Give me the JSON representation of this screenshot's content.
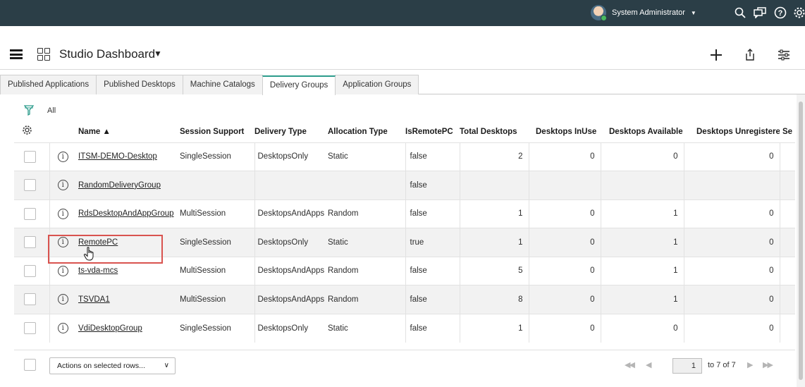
{
  "topbar": {
    "user_name": "System Administrator",
    "icons": [
      "search-icon",
      "chat-icon",
      "help-icon",
      "settings-icon"
    ]
  },
  "header": {
    "title": "Studio Dashboard",
    "icons": [
      "menu-icon",
      "dashboard-grid-icon",
      "add-icon",
      "share-icon",
      "filter-settings-icon"
    ]
  },
  "tabs": [
    {
      "label": "Published Applications",
      "active": false
    },
    {
      "label": "Published Desktops",
      "active": false
    },
    {
      "label": "Machine Catalogs",
      "active": false
    },
    {
      "label": "Delivery Groups",
      "active": true
    },
    {
      "label": "Application Groups",
      "active": false
    }
  ],
  "filter": {
    "label": "All"
  },
  "table": {
    "columns": [
      "Name ▲",
      "Session Support",
      "Delivery Type",
      "Allocation Type",
      "IsRemotePC",
      "Total Desktops",
      "Desktops InUse",
      "Desktops Available",
      "Desktops Unregistered",
      "Se"
    ],
    "rows": [
      {
        "name": "ITSM-DEMO-Desktop",
        "session": "SingleSession",
        "delivery": "DesktopsOnly",
        "allocation": "Static",
        "remote": "false",
        "total": "2",
        "inuse": "0",
        "available": "0",
        "unregistered": "0"
      },
      {
        "name": "RandomDeliveryGroup",
        "session": "",
        "delivery": "",
        "allocation": "",
        "remote": "false",
        "total": "",
        "inuse": "",
        "available": "",
        "unregistered": ""
      },
      {
        "name": "RdsDesktopAndAppGroup",
        "session": "MultiSession",
        "delivery": "DesktopsAndApps",
        "allocation": "Random",
        "remote": "false",
        "total": "1",
        "inuse": "0",
        "available": "1",
        "unregistered": "0"
      },
      {
        "name": "RemotePC",
        "session": "SingleSession",
        "delivery": "DesktopsOnly",
        "allocation": "Static",
        "remote": "true",
        "total": "1",
        "inuse": "0",
        "available": "1",
        "unregistered": "0"
      },
      {
        "name": "ts-vda-mcs",
        "session": "MultiSession",
        "delivery": "DesktopsAndApps",
        "allocation": "Random",
        "remote": "false",
        "total": "5",
        "inuse": "0",
        "available": "1",
        "unregistered": "0"
      },
      {
        "name": "TSVDA1",
        "session": "MultiSession",
        "delivery": "DesktopsAndApps",
        "allocation": "Random",
        "remote": "false",
        "total": "8",
        "inuse": "0",
        "available": "1",
        "unregistered": "0"
      },
      {
        "name": "VdiDesktopGroup",
        "session": "SingleSession",
        "delivery": "DesktopsOnly",
        "allocation": "Static",
        "remote": "false",
        "total": "1",
        "inuse": "0",
        "available": "0",
        "unregistered": "0"
      }
    ]
  },
  "footer": {
    "actions_label": "Actions on selected rows...",
    "page_value": "1",
    "page_of": "to 7 of 7"
  },
  "colors": {
    "topbar_bg": "#2b3e47",
    "tab_active_accent": "#2c9c8c",
    "highlight_border": "#d9534f",
    "alt_row_bg": "#f2f2f2"
  }
}
